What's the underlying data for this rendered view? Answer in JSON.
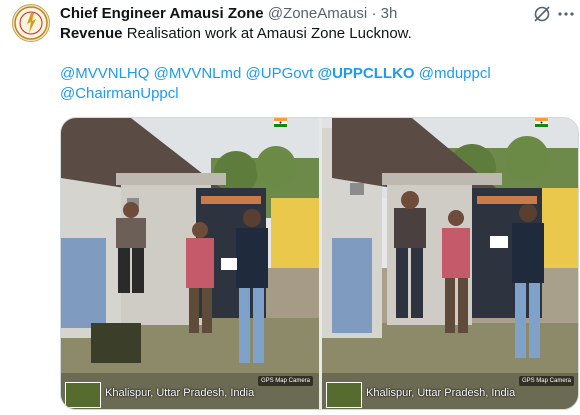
{
  "post": {
    "author": "Chief Engineer Amausi Zone",
    "handle": "@ZoneAmausi",
    "separator": "·",
    "time": "3h",
    "text_bold": "Revenue",
    "text_rest": " Realisation work at Amausi Zone Lucknow.",
    "mentions_line1": [
      "@MVVNLHQ",
      "@MVVNLmd",
      "@UPGovt",
      "@UPPCLLKO",
      "@mduppcl"
    ],
    "mentions_line2": [
      "@ChairmanUppcl"
    ]
  },
  "media": {
    "photo1_location": "Khalispur, Uttar Pradesh, India",
    "photo2_location": "Khalispur, Uttar Pradesh, India",
    "gps_badge": "GPS Map Camera"
  },
  "icons": [
    "avatar-logo",
    "grok-icon",
    "more-icon",
    "india-flag-icon"
  ]
}
